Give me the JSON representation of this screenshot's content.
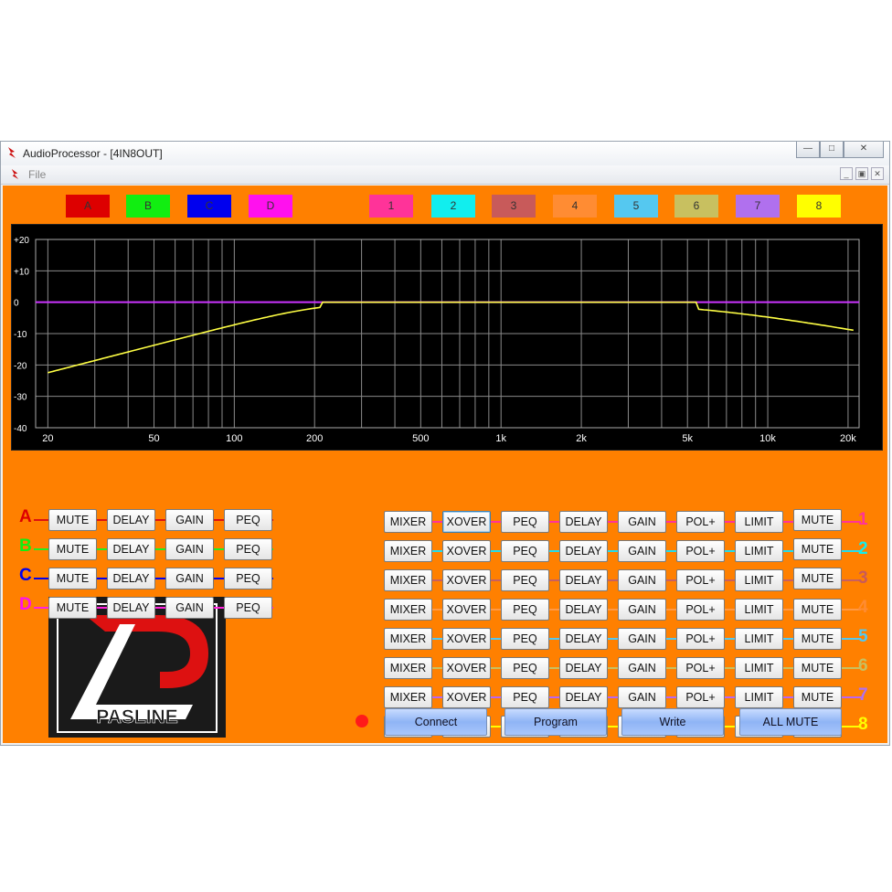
{
  "window": {
    "title": "AudioProcessor - [4IN8OUT]"
  },
  "menu": {
    "file": "File"
  },
  "input_channels": [
    {
      "label": "A",
      "color": "#dd0000",
      "row_color": "#dd1111"
    },
    {
      "label": "B",
      "color": "#11ee11",
      "row_color": "#22ee22"
    },
    {
      "label": "C",
      "color": "#0000ee",
      "row_color": "#0000ee"
    },
    {
      "label": "D",
      "color": "#ff11ee",
      "row_color": "#ff22dd"
    }
  ],
  "output_channels": [
    {
      "label": "1",
      "color": "#ff3399",
      "row_color": "#ff3399"
    },
    {
      "label": "2",
      "color": "#11eeee",
      "row_color": "#22ddee"
    },
    {
      "label": "3",
      "color": "#c85a5a",
      "row_color": "#c86060"
    },
    {
      "label": "4",
      "color": "#ff8c33",
      "row_color": "#ff9944"
    },
    {
      "label": "5",
      "color": "#55c8f0",
      "row_color": "#55c8f0"
    },
    {
      "label": "6",
      "color": "#c8c060",
      "row_color": "#c8c060"
    },
    {
      "label": "7",
      "color": "#b070ee",
      "row_color": "#bb66ee"
    },
    {
      "label": "8",
      "color": "#ffff00",
      "row_color": "#ffff00"
    }
  ],
  "graph": {
    "y_ticks": [
      "+20",
      "+10",
      "0",
      "-10",
      "-20",
      "-30",
      "-40"
    ],
    "x_ticks": [
      "20",
      "50",
      "100",
      "200",
      "500",
      "1k",
      "2k",
      "5k",
      "10k",
      "20k"
    ]
  },
  "input_buttons": [
    "MUTE",
    "DELAY",
    "GAIN",
    "PEQ"
  ],
  "output_buttons": [
    "MIXER",
    "XOVER",
    "PEQ",
    "DELAY",
    "GAIN",
    "POL+",
    "LIMIT",
    "MUTE"
  ],
  "bottom_buttons": [
    "Connect",
    "Program",
    "Write",
    "ALL MUTE"
  ],
  "logo": {
    "text": "PASLINE"
  },
  "colors": {
    "background": "#ff8000",
    "graph_bg": "#000000",
    "curve_yellow": "#ffff44",
    "curve_purple": "#cc33ff",
    "led": "#ff1a1a"
  }
}
